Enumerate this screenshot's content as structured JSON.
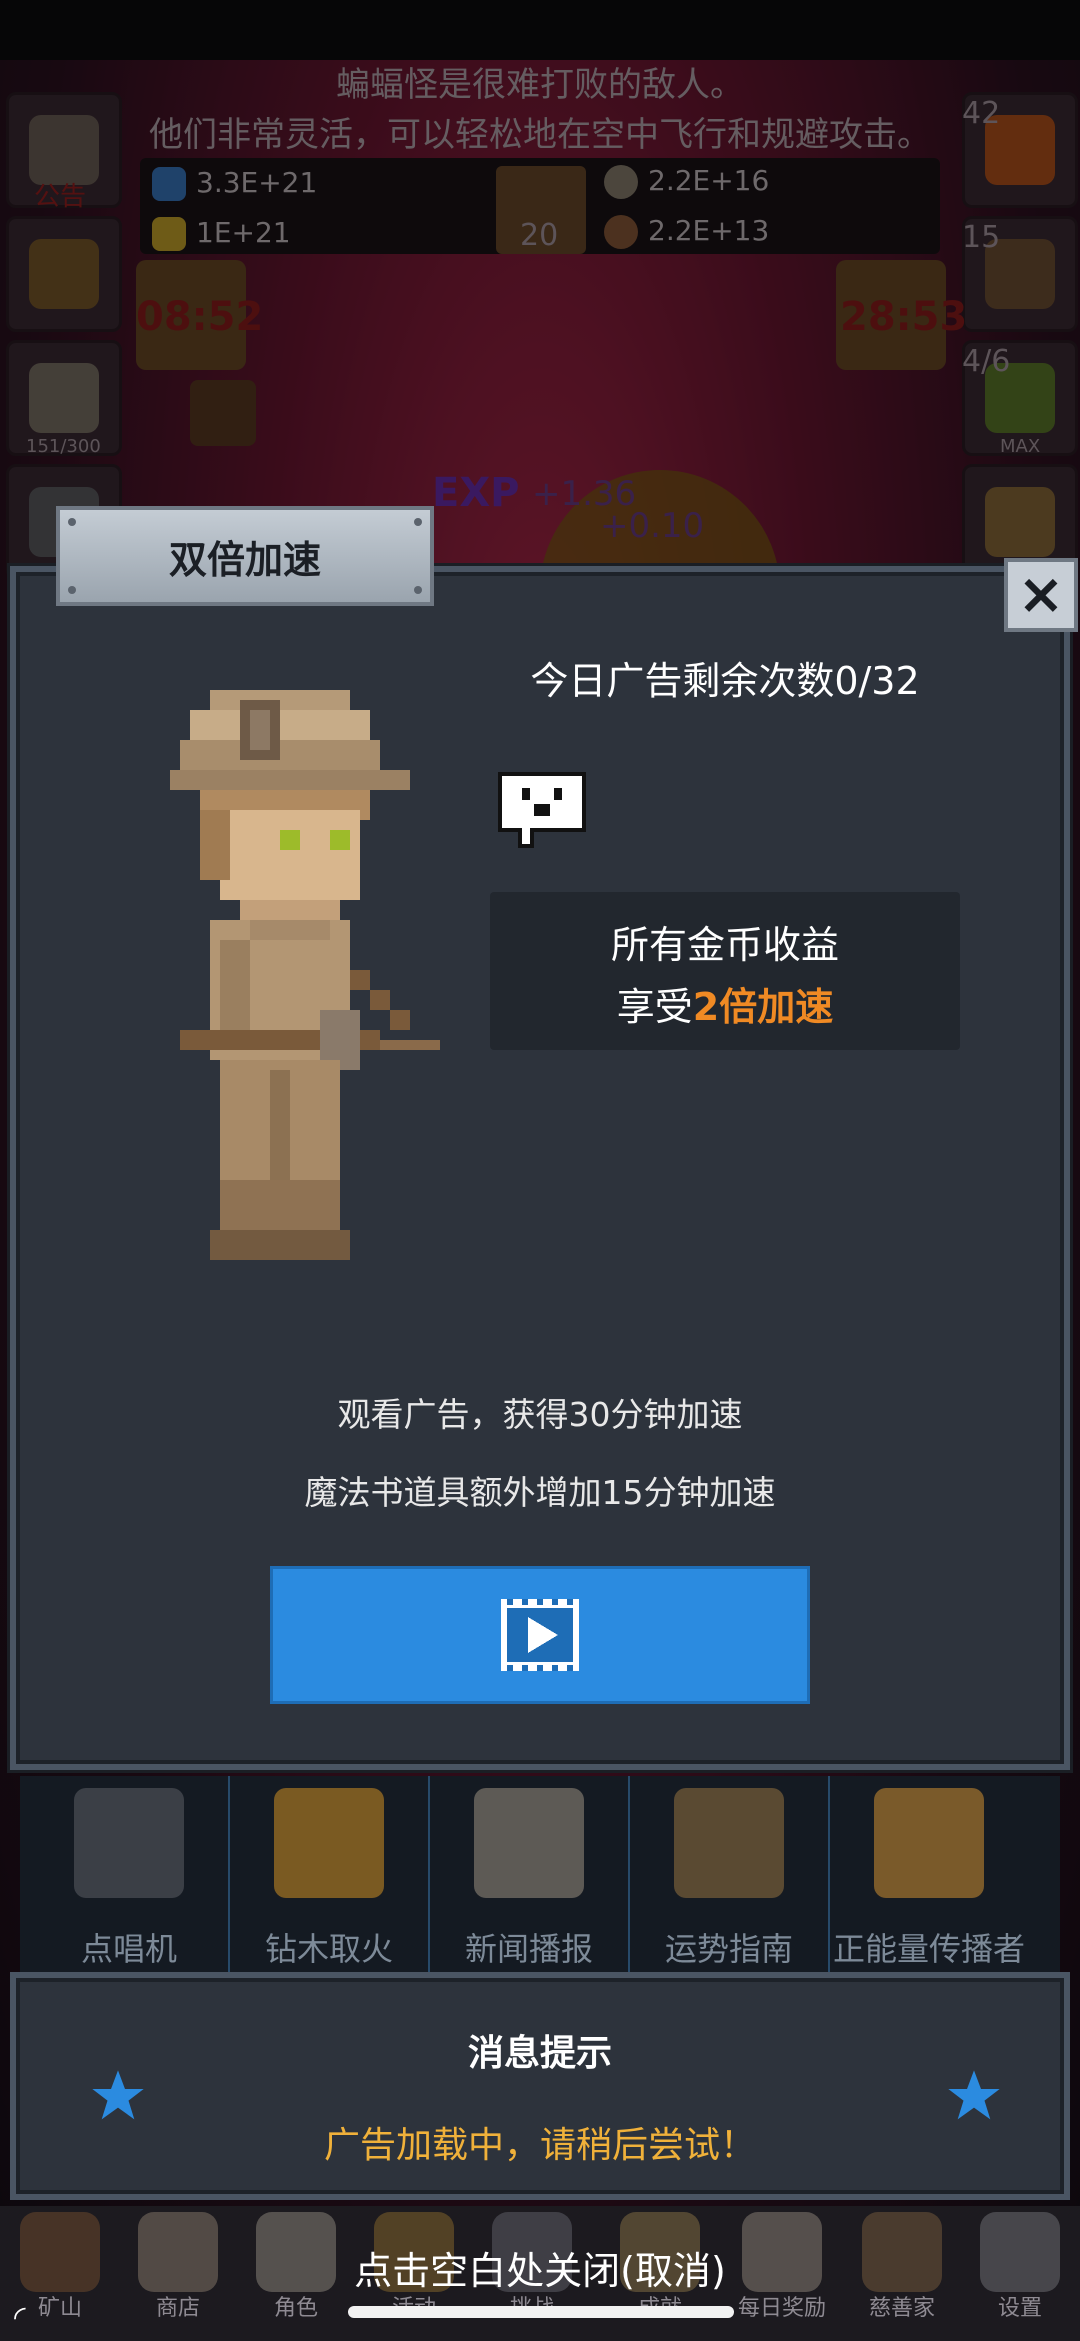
{
  "scene": {
    "ticker_line1": "蝙蝠怪是很难打败的敌人。",
    "ticker_line2": "他们非常灵活，可以轻松地在空中飞行和规避攻击。",
    "notice_label": "公告",
    "resources": [
      "3.3E+21",
      "1E+21",
      "2.2E+16",
      "2.2E+13"
    ],
    "book_count": "20",
    "timer_left": "08:52",
    "timer_right": "28:53",
    "potion_count": "42",
    "chest_count": "15",
    "slime_count": "4/6",
    "slime_max": "MAX",
    "mushroom_progress": "151/300",
    "exp_label": "EXP",
    "exp_gain": "+1.36",
    "exp_gain2": "+0.10"
  },
  "dialog": {
    "title": "双倍加速",
    "close_icon": "×",
    "ad_remaining": "今日广告剩余次数0/32",
    "benefit_line1": "所有金币收益",
    "benefit_prefix": "享受",
    "benefit_highlight": "2倍加速",
    "desc1": "观看广告，获得30分钟加速",
    "desc2": "魔法书道具额外增加15分钟加速"
  },
  "menu_strip": [
    "点唱机",
    "钻木取火",
    "新闻播报",
    "运势指南",
    "正能量传播者"
  ],
  "toast": {
    "title": "消息提示",
    "message": "广告加载中，请稍后尝试！"
  },
  "bottom_nav": [
    "矿山",
    "商店",
    "角色",
    "活动",
    "挑战",
    "成就",
    "每日奖励",
    "慈善家",
    "设置"
  ],
  "close_hint": "点击空白处关闭(取消)",
  "colors": {
    "accent_blue": "#2b8be0",
    "highlight_orange": "#f08a24",
    "toast_yellow": "#f0b13a",
    "panel_bg": "#2d333c"
  }
}
